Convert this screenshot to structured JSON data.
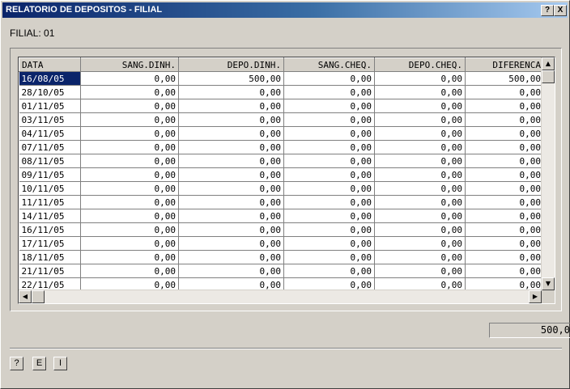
{
  "window": {
    "title": "RELATORIO DE DEPOSITOS - FILIAL",
    "help_button": "?",
    "close_button": "X"
  },
  "filial": {
    "label": "FILIAL: 01"
  },
  "table": {
    "columns": [
      "DATA",
      "SANG.DINH.",
      "DEPO.DINH.",
      "SANG.CHEQ.",
      "DEPO.CHEQ.",
      "DIFERENCA"
    ],
    "rows": [
      [
        "16/08/05",
        "0,00",
        "500,00",
        "0,00",
        "0,00",
        "500,00"
      ],
      [
        "28/10/05",
        "0,00",
        "0,00",
        "0,00",
        "0,00",
        "0,00"
      ],
      [
        "01/11/05",
        "0,00",
        "0,00",
        "0,00",
        "0,00",
        "0,00"
      ],
      [
        "03/11/05",
        "0,00",
        "0,00",
        "0,00",
        "0,00",
        "0,00"
      ],
      [
        "04/11/05",
        "0,00",
        "0,00",
        "0,00",
        "0,00",
        "0,00"
      ],
      [
        "07/11/05",
        "0,00",
        "0,00",
        "0,00",
        "0,00",
        "0,00"
      ],
      [
        "08/11/05",
        "0,00",
        "0,00",
        "0,00",
        "0,00",
        "0,00"
      ],
      [
        "09/11/05",
        "0,00",
        "0,00",
        "0,00",
        "0,00",
        "0,00"
      ],
      [
        "10/11/05",
        "0,00",
        "0,00",
        "0,00",
        "0,00",
        "0,00"
      ],
      [
        "11/11/05",
        "0,00",
        "0,00",
        "0,00",
        "0,00",
        "0,00"
      ],
      [
        "14/11/05",
        "0,00",
        "0,00",
        "0,00",
        "0,00",
        "0,00"
      ],
      [
        "16/11/05",
        "0,00",
        "0,00",
        "0,00",
        "0,00",
        "0,00"
      ],
      [
        "17/11/05",
        "0,00",
        "0,00",
        "0,00",
        "0,00",
        "0,00"
      ],
      [
        "18/11/05",
        "0,00",
        "0,00",
        "0,00",
        "0,00",
        "0,00"
      ],
      [
        "21/11/05",
        "0,00",
        "0,00",
        "0,00",
        "0,00",
        "0,00"
      ],
      [
        "22/11/05",
        "0,00",
        "0,00",
        "0,00",
        "0,00",
        "0,00"
      ]
    ],
    "selected_row": 0
  },
  "total": {
    "value": "500,0"
  },
  "buttons": {
    "help": "?",
    "e": "E",
    "i": "I"
  },
  "scroll_icons": {
    "up": "scroll-up-icon",
    "down": "scroll-down-icon",
    "left": "scroll-left-icon",
    "right": "scroll-right-icon"
  }
}
